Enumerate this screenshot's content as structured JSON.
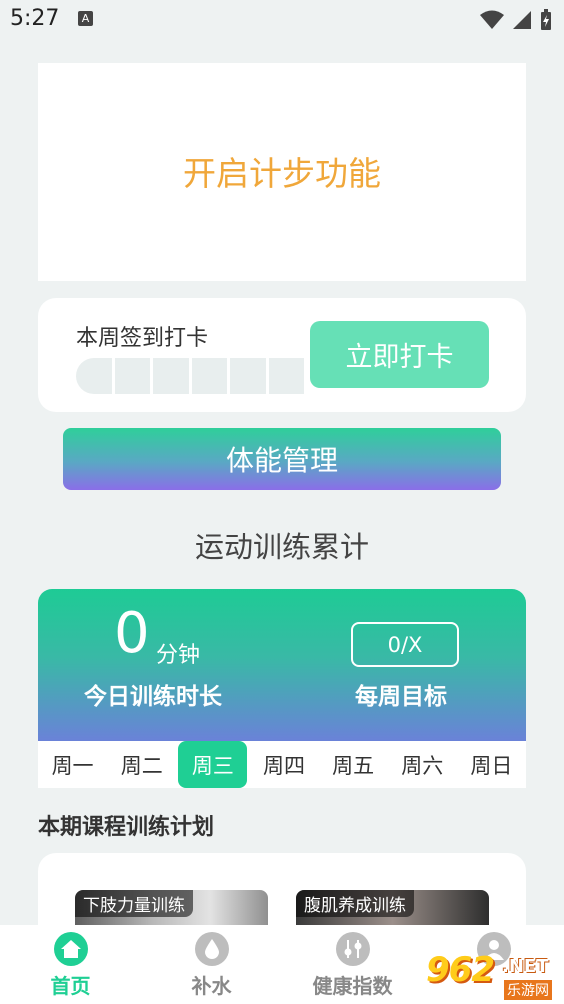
{
  "status_bar": {
    "time": "5:27",
    "notification_badge": "A"
  },
  "step": {
    "label": "开启计步功能"
  },
  "checkin": {
    "title": "本周签到打卡",
    "days_checked": 0,
    "total_days": 7,
    "button_label": "立即打卡"
  },
  "fitness": {
    "button_label": "体能管理"
  },
  "training": {
    "section_title": "运动训练累计",
    "today_value": "0",
    "today_unit": "分钟",
    "today_label": "今日训练时长",
    "goal_value": "0/X",
    "goal_label": "每周目标"
  },
  "weekdays": {
    "selected_index": 2,
    "days": [
      "周一",
      "周二",
      "周三",
      "周四",
      "周五",
      "周六",
      "周日"
    ]
  },
  "plan": {
    "title": "本期课程训练计划",
    "courses": [
      {
        "label": "下肢力量训练"
      },
      {
        "label": "腹肌养成训练"
      }
    ]
  },
  "tabbar": {
    "items": [
      {
        "label": "首页",
        "icon": "home-icon",
        "active": true
      },
      {
        "label": "补水",
        "icon": "water-drop-icon",
        "active": false
      },
      {
        "label": "健康指数",
        "icon": "sliders-icon",
        "active": false
      },
      {
        "label": "",
        "icon": "user-icon",
        "active": false
      }
    ]
  },
  "watermark": {
    "brand": "962",
    "suffix": ".NET",
    "subtitle": "乐游网"
  },
  "colors": {
    "accent": "#1fcf94",
    "step_text": "#f0a73a",
    "checkin_button": "#66e0b6",
    "gradient_end": "#8a6ee8"
  }
}
